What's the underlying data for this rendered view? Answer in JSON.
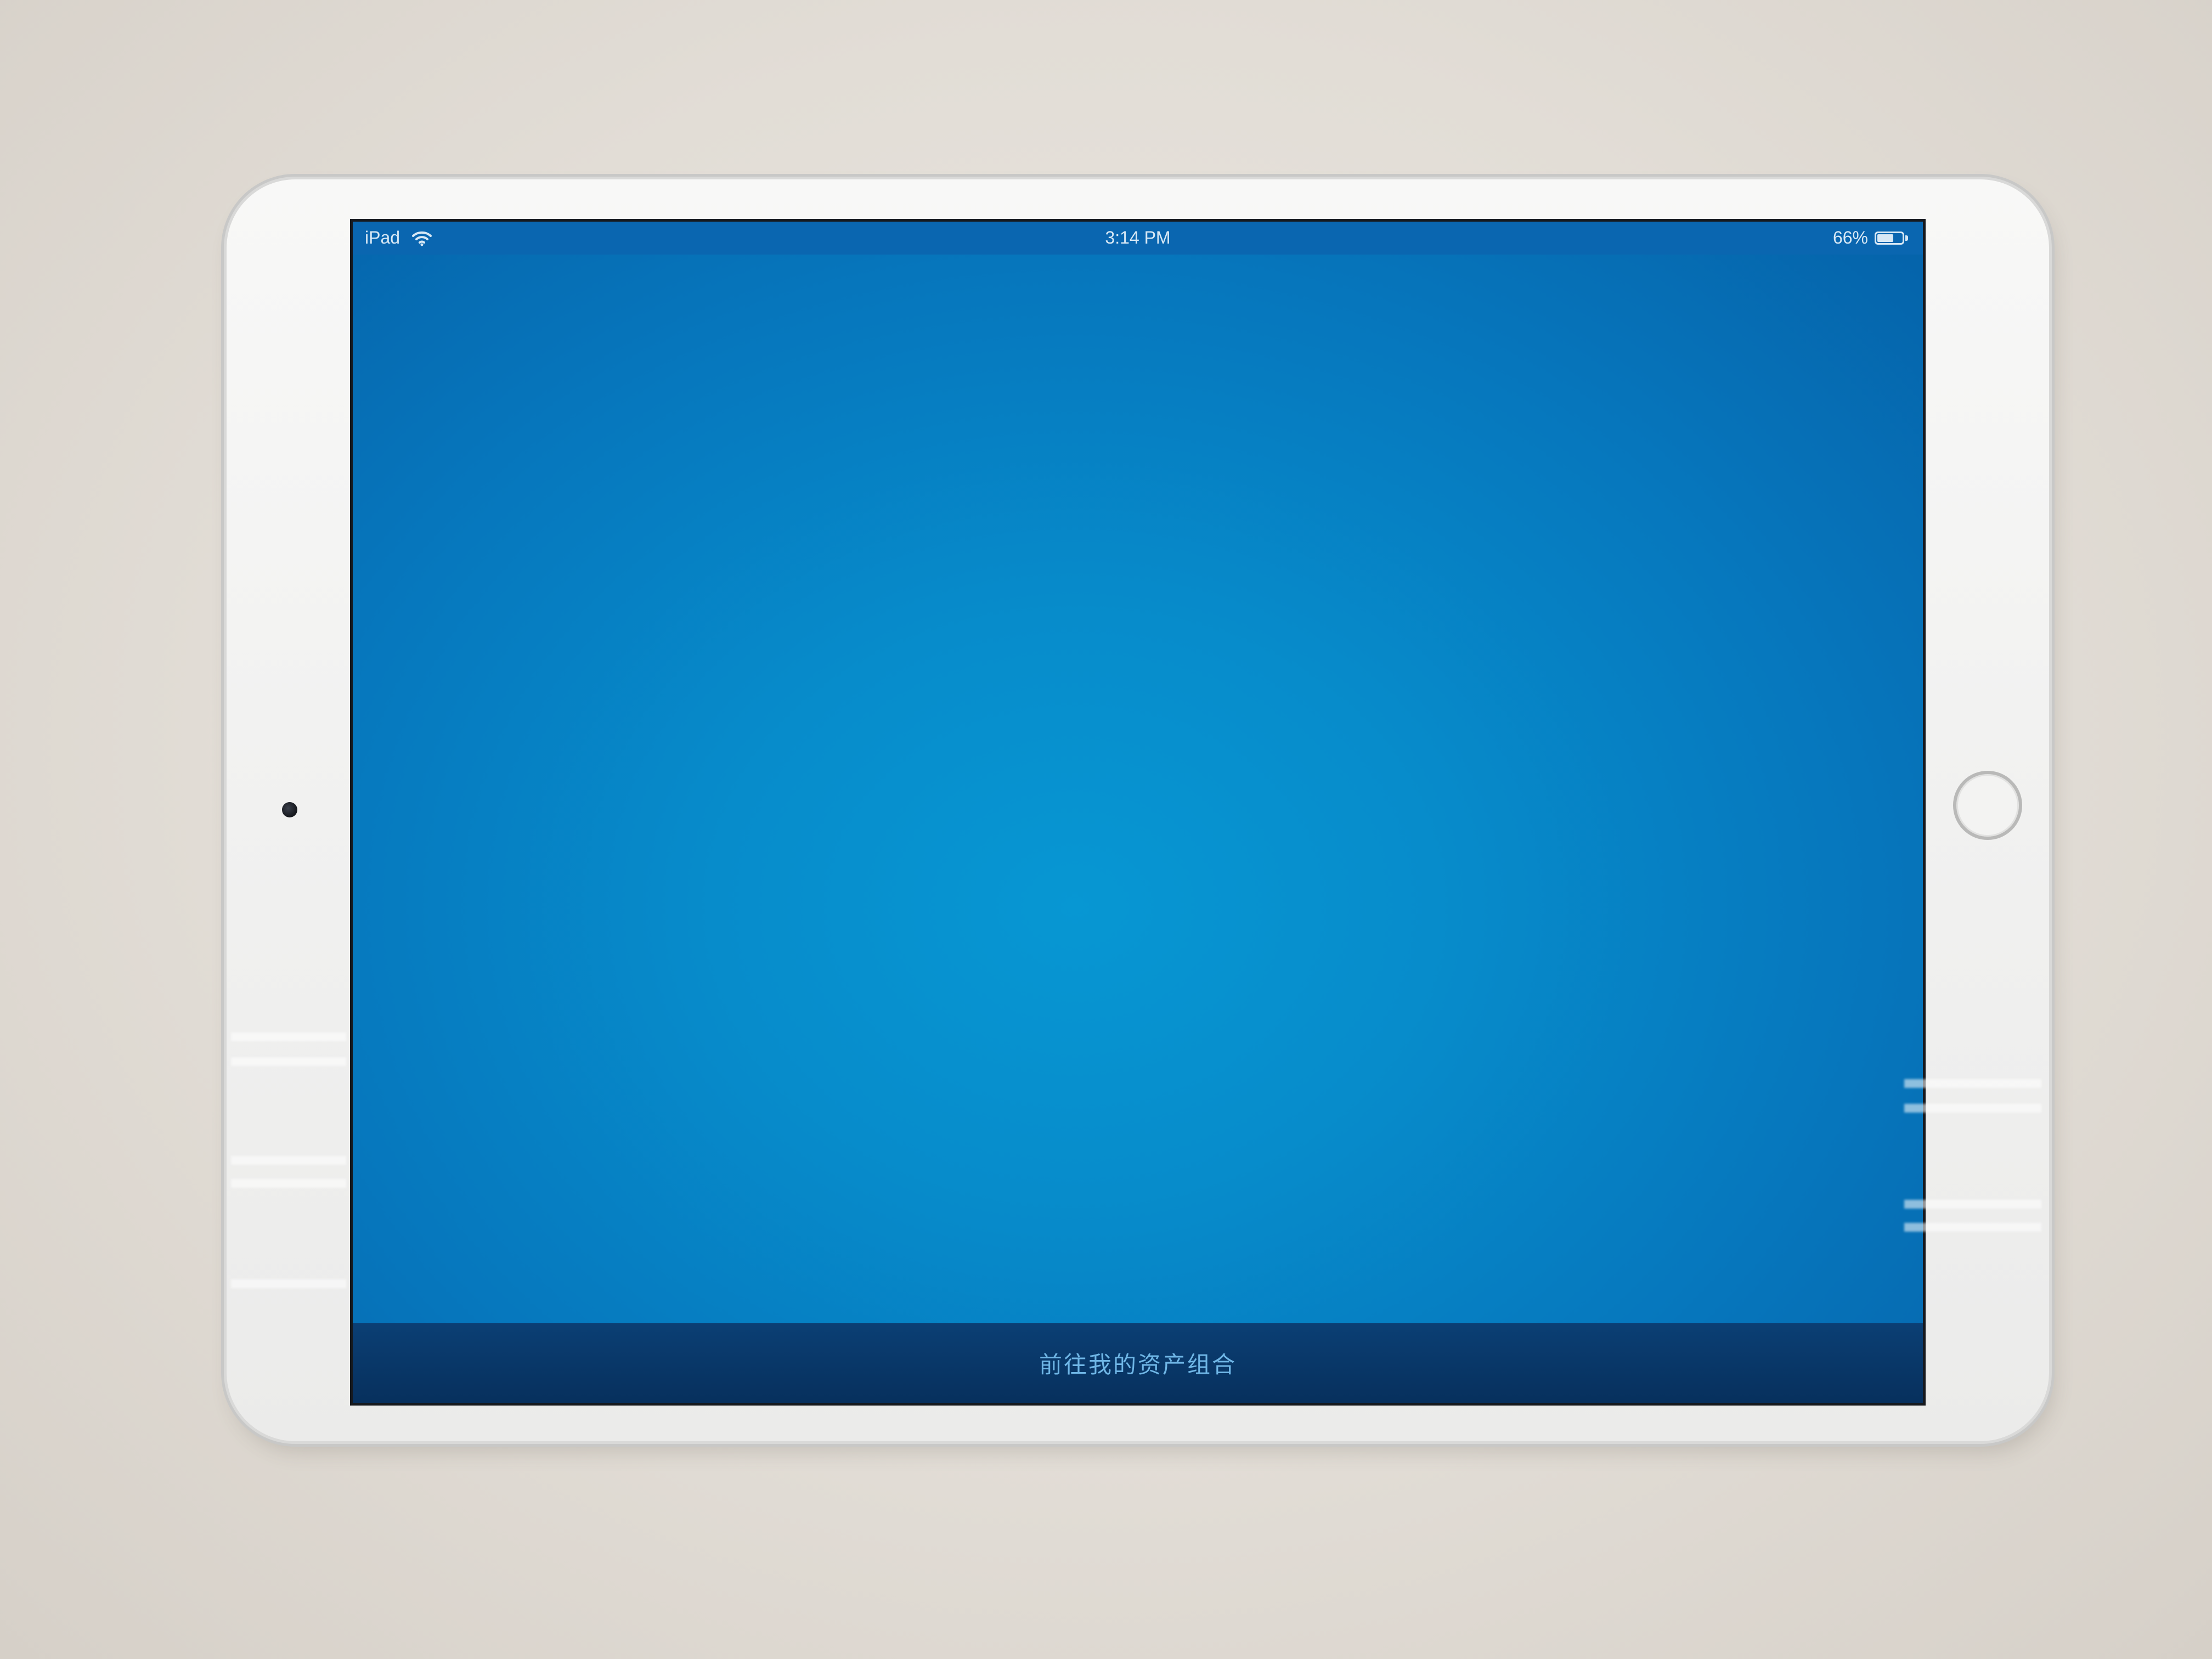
{
  "status_bar": {
    "device_label": "iPad",
    "time": "3:14 PM",
    "battery_text": "66%",
    "battery_level": 0.66,
    "icons": [
      "wifi-icon",
      "battery-icon"
    ]
  },
  "bottom_bar": {
    "link_label": "前往我的资产组合"
  },
  "colors": {
    "screen_blue": "#078ccb",
    "status_bar": "#0a66b0",
    "bottom_bar": "#07305d",
    "link_text": "#6fb6e6",
    "device_body": "#f1f1f0"
  }
}
